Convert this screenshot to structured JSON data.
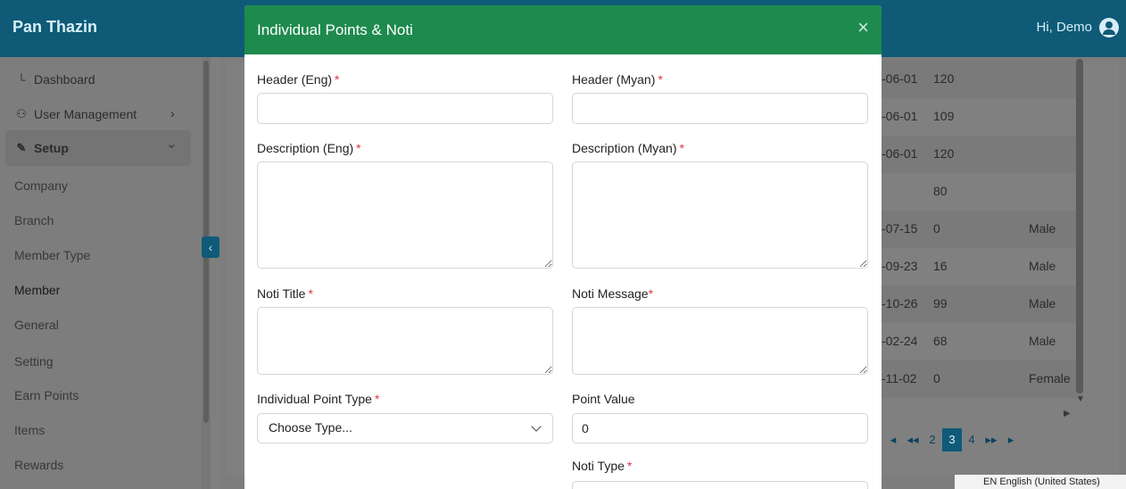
{
  "app": {
    "brand": "Pan Thazin",
    "greeting": "Hi, Demo",
    "user_icon": "user-circle-icon"
  },
  "sidebar": {
    "items": [
      {
        "label": "Dashboard",
        "icon": "chart-line-icon"
      },
      {
        "label": "User Management",
        "icon": "users-icon"
      },
      {
        "label": "Setup",
        "icon": "edit-icon"
      }
    ],
    "sub_items": [
      "Company",
      "Branch",
      "Member Type",
      "Member",
      "General",
      "Setting",
      "Earn Points",
      "Items",
      "Rewards"
    ]
  },
  "table": {
    "rows": [
      {
        "date": "-06-01",
        "points": "120",
        "gender": ""
      },
      {
        "date": "-06-01",
        "points": "109",
        "gender": ""
      },
      {
        "date": "-06-01",
        "points": "120",
        "gender": ""
      },
      {
        "date": "",
        "points": "80",
        "gender": ""
      },
      {
        "date": "-07-15",
        "points": "0",
        "gender": "Male"
      },
      {
        "date": "-09-23",
        "points": "16",
        "gender": "Male"
      },
      {
        "date": "-10-26",
        "points": "99",
        "gender": "Male"
      },
      {
        "date": "-02-24",
        "points": "68",
        "gender": "Male"
      },
      {
        "date": "-11-02",
        "points": "0",
        "gender": "Female"
      }
    ]
  },
  "pagination": {
    "pages": [
      "2",
      "3",
      "4"
    ],
    "current": "3"
  },
  "taskbar": {
    "language": "EN English (United States)"
  },
  "modal": {
    "title": "Individual Points & Noti",
    "close": "×",
    "header_eng_label": "Header (Eng)",
    "header_myan_label": "Header (Myan)",
    "desc_eng_label": "Description (Eng)",
    "desc_myan_label": "Description (Myan)",
    "noti_title_label": "Noti Title",
    "noti_message_label": "Noti Message",
    "point_type_label": "Individual Point Type",
    "point_type_value": "Choose Type...",
    "point_value_label": "Point Value",
    "point_value": "0",
    "noti_type_label": "Noti Type",
    "required_mark": "*"
  },
  "colors": {
    "modal_header": "#1e8a4e",
    "topbar": "#0e5a77",
    "required": "#dc3545"
  }
}
